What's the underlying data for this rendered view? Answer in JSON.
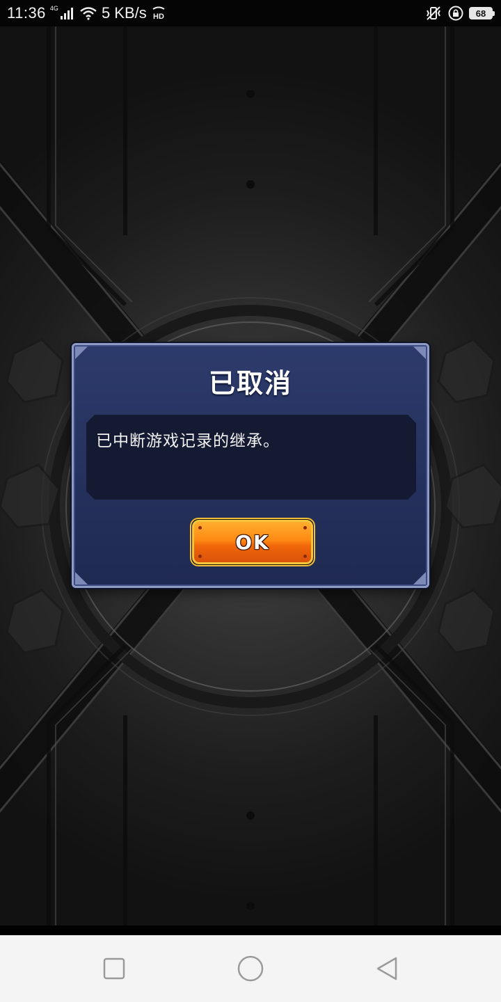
{
  "status_bar": {
    "time": "11:36",
    "network_type": "4G",
    "speed": "5 KB/s",
    "hd_label": "HD",
    "battery_level": "68",
    "icons": [
      "signal-icon",
      "wifi-icon",
      "hd-icon",
      "vibrate-icon",
      "lock-rotation-icon",
      "battery-icon"
    ]
  },
  "dialog": {
    "title": "已取消",
    "message": "已中断游戏记录的继承。",
    "ok_label": "OK"
  },
  "nav_bar": {
    "buttons": [
      "recent-apps-button",
      "home-button",
      "back-button"
    ]
  },
  "colors": {
    "dialog_bg": "#2d3b6c",
    "dialog_border": "#8f9bc4",
    "message_bg": "#151a33",
    "button_orange": "#ff8a14",
    "button_border": "#f5c53d",
    "nav_bar_bg": "#f4f4f4"
  }
}
